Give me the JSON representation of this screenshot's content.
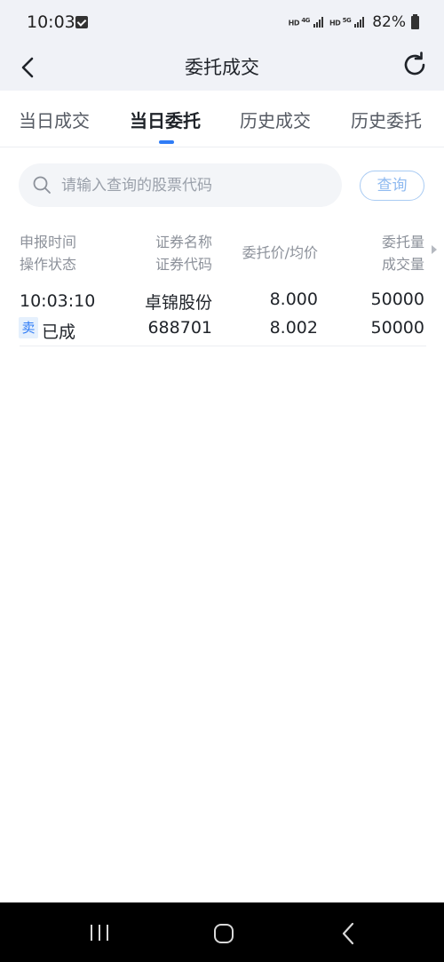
{
  "status_bar": {
    "time": "10:03",
    "net1": "HD",
    "net1_type": "4G",
    "net2": "HD",
    "net2_type": "5G",
    "battery": "82%"
  },
  "nav": {
    "title": "委托成交",
    "back_icon": "chevron-left-icon",
    "refresh_icon": "refresh-icon"
  },
  "tabs": [
    {
      "label": "当日成交",
      "active": false
    },
    {
      "label": "当日委托",
      "active": true
    },
    {
      "label": "历史成交",
      "active": false
    },
    {
      "label": "历史委托",
      "active": false
    }
  ],
  "search": {
    "placeholder": "请输入查询的股票代码",
    "value": "",
    "button_label": "查询"
  },
  "table": {
    "headers": {
      "col1_top": "申报时间",
      "col1_bottom": "操作状态",
      "col2_top": "证券名称",
      "col2_bottom": "证券代码",
      "col3": "委托价/均价",
      "col4_top": "委托量",
      "col4_bottom": "成交量"
    },
    "rows": [
      {
        "time": "10:03:10",
        "side": "卖",
        "status": "已成",
        "name": "卓锦股份",
        "code": "688701",
        "order_price": "8.000",
        "avg_price": "8.002",
        "order_qty": "50000",
        "filled_qty": "50000"
      }
    ]
  },
  "colors": {
    "accent": "#2f7cf6",
    "header_bg": "#f0f2f7"
  }
}
